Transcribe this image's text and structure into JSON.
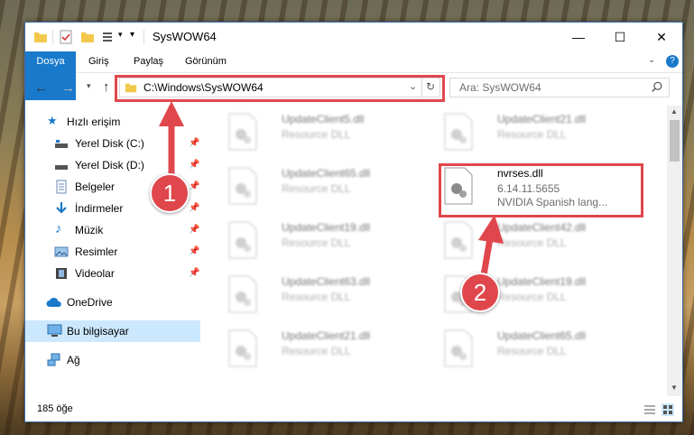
{
  "window": {
    "title": "SysWOW64",
    "controls": {
      "minimize": "—",
      "maximize": "☐",
      "close": "✕"
    }
  },
  "ribbon": {
    "tabs": [
      "Dosya",
      "Giriş",
      "Paylaş",
      "Görünüm"
    ]
  },
  "nav": {
    "path": "C:\\Windows\\SysWOW64",
    "search_placeholder": "Ara: SysWOW64"
  },
  "sidebar": {
    "quick_access": "Hızlı erişim",
    "items": [
      "Yerel Disk (C:)",
      "Yerel Disk (D:)",
      "Belgeler",
      "İndirmeler",
      "Müzik",
      "Resimler",
      "Videolar"
    ],
    "onedrive": "OneDrive",
    "this_pc": "Bu bilgisayar",
    "network": "Ağ"
  },
  "files": [
    {
      "name": "UpdateClient5.dll",
      "desc": "Resource DLL"
    },
    {
      "name": "UpdateClient21.dll",
      "desc": "Resource DLL"
    },
    {
      "name": "UpdateClient65.dll",
      "desc": "Resource DLL"
    },
    {
      "name": "nvrses.dll",
      "desc": "6.14.11.5655",
      "desc2": "NVIDIA Spanish lang..."
    },
    {
      "name": "UpdateClient19.dll",
      "desc": "Resource DLL"
    },
    {
      "name": "UpdateClient42.dll",
      "desc": "Resource DLL"
    },
    {
      "name": "UpdateClient63.dll",
      "desc": "Resource DLL"
    },
    {
      "name": "UpdateClient19.dll",
      "desc": "Resource DLL"
    },
    {
      "name": "UpdateClient21.dll",
      "desc": "Resource DLL"
    },
    {
      "name": "UpdateClient65.dll",
      "desc": "Resource DLL"
    }
  ],
  "status": {
    "count": "185 öğe"
  },
  "annotations": {
    "badge1": "1",
    "badge2": "2"
  },
  "colors": {
    "accent": "#1979ca",
    "highlight": "#e0474c",
    "selected": "#cce8ff"
  }
}
